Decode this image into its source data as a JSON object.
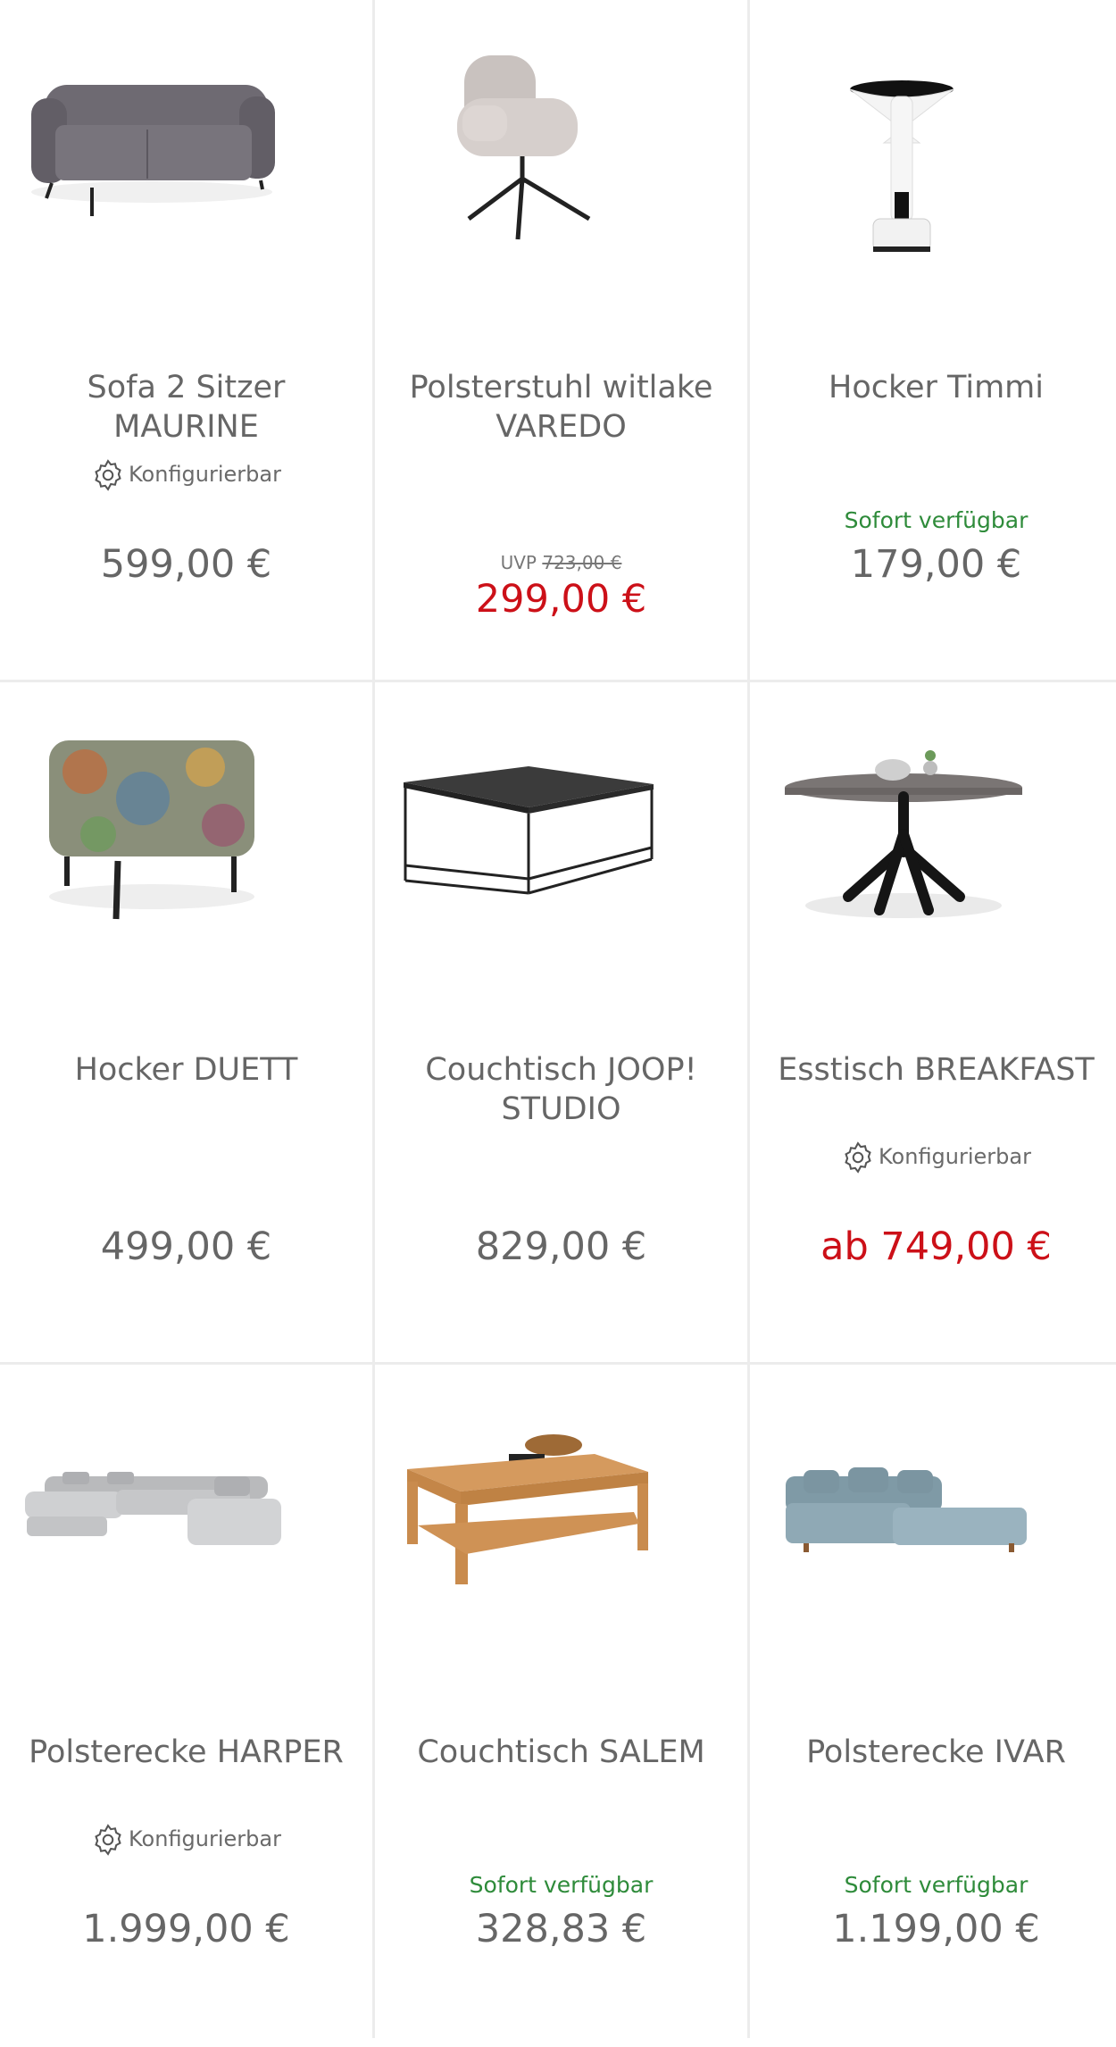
{
  "products": [
    {
      "title": "Sofa 2 Sitzer MAURINE",
      "configurable": "Konfigurierbar",
      "availability": "",
      "uvp_label": "",
      "uvp_price": "",
      "price": "599,00 €"
    },
    {
      "title": "Polsterstuhl witlake VAREDO",
      "configurable": "",
      "availability": "",
      "uvp_label": "UVP",
      "uvp_price": "723,00 €",
      "price": "299,00 €"
    },
    {
      "title": "Hocker Timmi",
      "configurable": "",
      "availability": "Sofort verfügbar",
      "uvp_label": "",
      "uvp_price": "",
      "price": "179,00 €"
    },
    {
      "title": "Hocker DUETT",
      "configurable": "",
      "availability": "",
      "uvp_label": "",
      "uvp_price": "",
      "price": "499,00 €"
    },
    {
      "title": "Couchtisch JOOP! STUDIO",
      "configurable": "",
      "availability": "",
      "uvp_label": "",
      "uvp_price": "",
      "price": "829,00 €"
    },
    {
      "title": "Esstisch BREAKFAST",
      "configurable": "Konfigurierbar",
      "availability": "",
      "uvp_label": "",
      "uvp_price": "",
      "price": "ab 749,00 €"
    },
    {
      "title": "Polsterecke HARPER",
      "configurable": "Konfigurierbar",
      "availability": "",
      "uvp_label": "",
      "uvp_price": "",
      "price": "1.999,00 €"
    },
    {
      "title": "Couchtisch SALEM",
      "configurable": "",
      "availability": "Sofort verfügbar",
      "uvp_label": "",
      "uvp_price": "",
      "price": "328,83 €"
    },
    {
      "title": "Polsterecke IVAR",
      "configurable": "",
      "availability": "Sofort verfügbar",
      "uvp_label": "",
      "uvp_price": "",
      "price": "1.199,00 €"
    }
  ],
  "colors": {
    "price_regular": "#666666",
    "price_sale": "#cc1018",
    "availability": "#2e8b3a",
    "grid_line": "#ececec"
  },
  "icons": {
    "configurable": "gear-icon"
  }
}
